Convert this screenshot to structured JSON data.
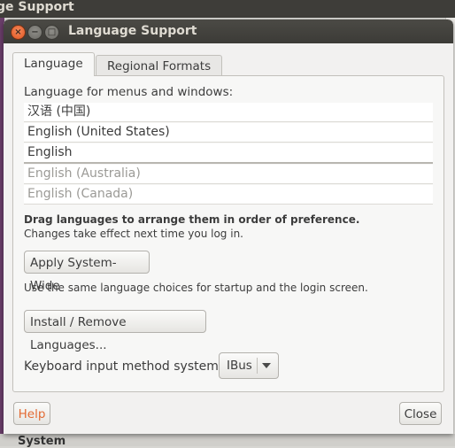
{
  "background": {
    "window_title": "ge Support",
    "bottom_text": "System"
  },
  "window": {
    "title": "Language Support"
  },
  "tabs": [
    {
      "label": "Language",
      "active": true
    },
    {
      "label": "Regional Formats",
      "active": false
    }
  ],
  "language_tab": {
    "list_label": "Language for menus and windows:",
    "languages": [
      {
        "label": "汉语 (中国)",
        "enabled": true
      },
      {
        "label": "English (United States)",
        "enabled": true
      },
      {
        "label": "English",
        "enabled": true
      },
      {
        "label": "English (Australia)",
        "enabled": false
      },
      {
        "label": "English (Canada)",
        "enabled": false
      }
    ],
    "drag_note": "Drag languages to arrange them in order of preference.",
    "effect_note": "Changes take effect next time you log in.",
    "apply_button": "Apply System-Wide",
    "system_note": "Use the same language choices for startup and the login screen.",
    "install_button": "Install / Remove Languages...",
    "keyboard_label": "Keyboard input method system:",
    "keyboard_value": "IBus"
  },
  "footer": {
    "help": "Help",
    "close": "Close"
  }
}
